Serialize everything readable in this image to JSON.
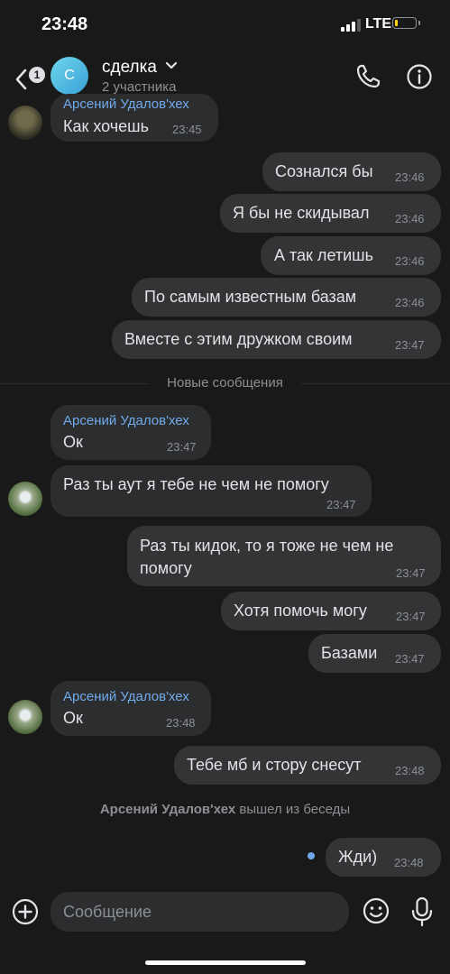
{
  "status_bar": {
    "time": "23:48",
    "network": "LTE",
    "battery_level": 0.15,
    "battery_color": "#ffd60a"
  },
  "header": {
    "back_badge": "1",
    "avatar_letter": "С",
    "title": "сделка",
    "subtitle": "2 участника"
  },
  "messages": {
    "m1": {
      "sender": "Арсений Удалов'хех",
      "text": "Как хочешь",
      "time": "23:45"
    },
    "m2": {
      "text": "Сознался бы",
      "time": "23:46"
    },
    "m3": {
      "text": "Я бы не скидывал",
      "time": "23:46"
    },
    "m4": {
      "text": "А так летишь",
      "time": "23:46"
    },
    "m5": {
      "text": "По самым известным базам",
      "time": "23:46"
    },
    "m6": {
      "text": "Вместе с этим дружком своим",
      "time": "23:47"
    },
    "divider": "Новые сообщения",
    "m7": {
      "sender": "Арсений Удалов'хех",
      "text": "Ок",
      "time": "23:47"
    },
    "m8": {
      "text": "Раз ты аут я тебе не чем не помогу",
      "time": "23:47"
    },
    "m9": {
      "text_line1": "Раз ты кидок, то я тоже не чем не",
      "text_line2": "помогу",
      "time": "23:47"
    },
    "m10": {
      "text": "Хотя помочь могу",
      "time": "23:47"
    },
    "m11": {
      "text": "Базами",
      "time": "23:47"
    },
    "m12": {
      "sender": "Арсений Удалов'хех",
      "text": "Ок",
      "time": "23:48"
    },
    "m13": {
      "text": "Тебе мб и стору снесут",
      "time": "23:48"
    },
    "service": {
      "name": "Арсений Удалов'хех",
      "action": "вышел из беседы"
    },
    "m14": {
      "text": "Жди)",
      "time": "23:48"
    }
  },
  "composer": {
    "placeholder": "Сообщение"
  },
  "icons": {
    "back": "chevron-left-icon",
    "title_dropdown": "chevron-down-icon",
    "call": "phone-icon",
    "info": "info-icon",
    "attach": "add-circle-icon",
    "emoji": "smile-icon",
    "voice": "microphone-icon"
  },
  "colors": {
    "background": "#19191a",
    "bubble_in": "#2c2d2e",
    "bubble_out": "#333435",
    "accent": "#71aaeb",
    "secondary_text": "#8c8f94"
  }
}
